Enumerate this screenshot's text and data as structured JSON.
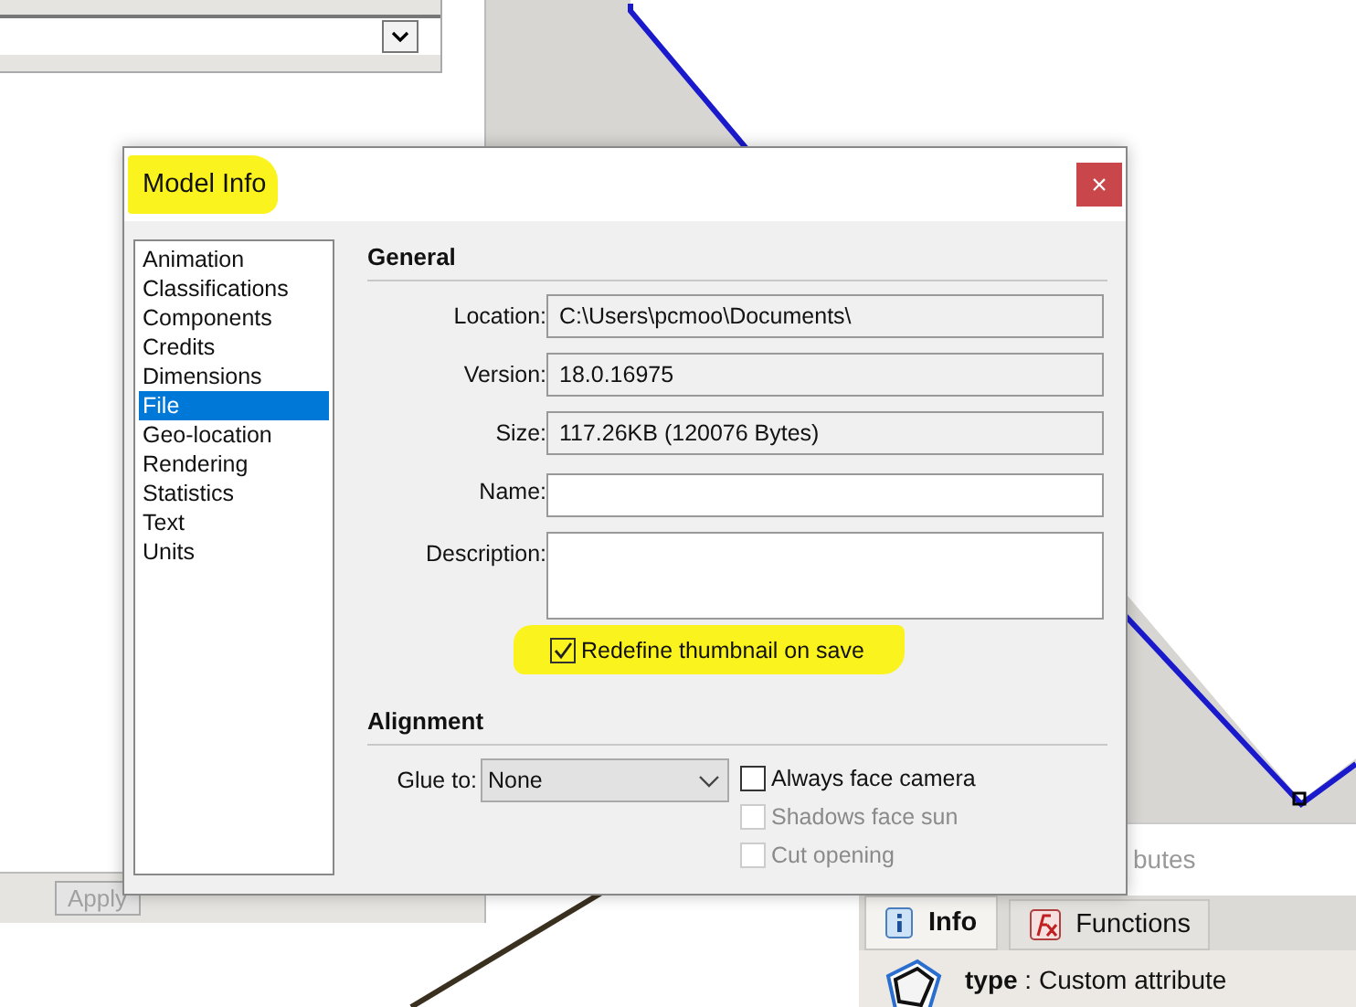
{
  "background": {
    "apply_button": {
      "label": "Apply",
      "disabled": true
    },
    "attributes_label": "butes",
    "tabs": [
      {
        "label": "Info",
        "selected": true,
        "kind": "info"
      },
      {
        "label": "Functions",
        "selected": false,
        "kind": "fx"
      }
    ],
    "entity_text": "**type** : Custom attribute"
  },
  "dialog": {
    "title": "Model Info",
    "title_highlighted": true,
    "close": "×",
    "categories": [
      {
        "label": "Animation",
        "selected": false
      },
      {
        "label": "Classifications",
        "selected": false
      },
      {
        "label": "Components",
        "selected": false
      },
      {
        "label": "Credits",
        "selected": false
      },
      {
        "label": "Dimensions",
        "selected": false
      },
      {
        "label": "File",
        "selected": true
      },
      {
        "label": "Geo-location",
        "selected": false
      },
      {
        "label": "Rendering",
        "selected": false
      },
      {
        "label": "Statistics",
        "selected": false
      },
      {
        "label": "Text",
        "selected": false
      },
      {
        "label": "Units",
        "selected": false
      }
    ],
    "general": {
      "title": "General",
      "fields": [
        {
          "label": "Location:",
          "value": "C:\\Users\\pcmoo\\Documents\\",
          "kind": "readonly"
        },
        {
          "label": "Version:",
          "value": "18.0.16975",
          "kind": "readonly"
        },
        {
          "label": "Size:",
          "value": "117.26KB (120076 Bytes)",
          "kind": "readonly"
        },
        {
          "label": "Name:",
          "kind": "text"
        },
        {
          "label": "Description:",
          "kind": "textarea"
        }
      ],
      "thumbnail": {
        "label": "Redefine thumbnail on save",
        "checked": true,
        "highlighted": true
      }
    },
    "alignment": {
      "title": "Alignment",
      "glue_label": "Glue to:",
      "glue_value": "None",
      "options": [
        {
          "label": "Always face camera",
          "checked": false,
          "disabled": false
        },
        {
          "label": "Shadows face sun",
          "checked": false,
          "disabled": true
        },
        {
          "label": "Cut opening",
          "checked": false,
          "disabled": true
        }
      ]
    }
  }
}
